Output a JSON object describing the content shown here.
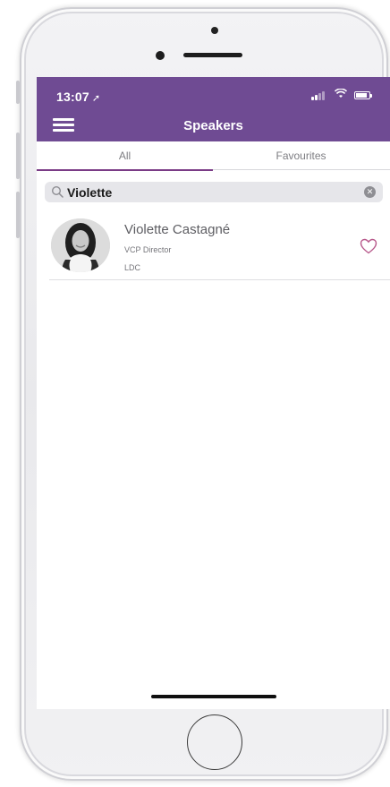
{
  "status_bar": {
    "time": "13:07",
    "location_arrow_icon": "location-arrow-icon",
    "signal_icon": "cellular-signal-icon",
    "wifi_icon": "wifi-icon",
    "battery_icon": "battery-icon"
  },
  "nav": {
    "menu_icon": "hamburger-menu-icon",
    "title": "Speakers"
  },
  "tabs": [
    {
      "label": "All",
      "active": true
    },
    {
      "label": "Favourites",
      "active": false
    }
  ],
  "search": {
    "value": "Violette",
    "search_icon": "search-icon",
    "clear_icon": "clear-icon"
  },
  "speakers": [
    {
      "name": "Violette Castagné",
      "role": "VCP Director",
      "company": "LDC",
      "favourite": false
    }
  ],
  "colors": {
    "brand_purple": "#6f4b93",
    "active_tab_underline": "#7a3b86",
    "heart_outline": "#b85a8c"
  }
}
